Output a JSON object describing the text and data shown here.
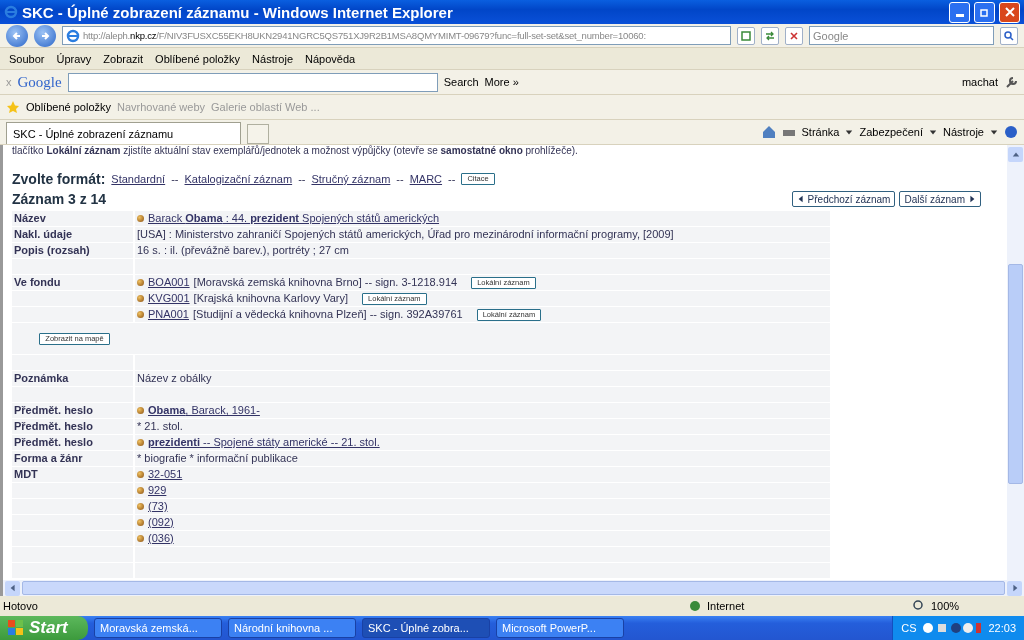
{
  "window": {
    "title": "SKC - Úplné zobrazení záznamu - Windows Internet Explorer"
  },
  "address": {
    "url_prefix": "http://aleph.",
    "url_host": "nkp.cz",
    "url_rest": "/F/NIV3FUSXC55EKH8UKN2941NGRC5QS751XJ9R2B1MSA8QMYMIMT-09679?func=full-set-set&set_number=10060:",
    "search_placeholder": "Google"
  },
  "menu": [
    "Soubor",
    "Úpravy",
    "Zobrazit",
    "Oblíbené položky",
    "Nástroje",
    "Nápověda"
  ],
  "google_bar": {
    "close": "x",
    "logo": "Google",
    "search": "Search",
    "more": "More »",
    "user": "machat"
  },
  "favorites_bar": {
    "favorites": "Oblíbené položky",
    "items": [
      "Navrhované weby",
      "Galerie oblastí Web ..."
    ]
  },
  "tabs": [
    {
      "label": "SKC - Úplné zobrazení záznamu",
      "selected": true
    }
  ],
  "command_bar": [
    "Stránka",
    "Zabezpečení",
    "Nástroje"
  ],
  "page": {
    "intro": "tlačítko **Lokální záznam** zjistíte aktuální stav exemplářů/jednotek a možnost výpůjčky (otevře se **samostatné okno** prohlížeče).",
    "format_label": "Zvolte formát:",
    "formats": [
      {
        "kind": "link",
        "label": "Standardní"
      },
      {
        "kind": "sep",
        "label": "--"
      },
      {
        "kind": "link",
        "label": "Katalogizační záznam"
      },
      {
        "kind": "sep",
        "label": "--"
      },
      {
        "kind": "link",
        "label": "Stručný záznam"
      },
      {
        "kind": "sep",
        "label": "--"
      },
      {
        "kind": "link",
        "label": "MARC"
      },
      {
        "kind": "sep",
        "label": "--"
      },
      {
        "kind": "button",
        "label": "Citace"
      }
    ],
    "record_title": "Záznam 3 z 14",
    "prev": "Předchozí záznam",
    "next": "Další záznam",
    "rows": [
      {
        "label": "Název",
        "kind": "link",
        "value": "Barack **Obama** : 44. **prezident** Spojených států amerických"
      },
      {
        "label": "Nakl. údaje",
        "kind": "text",
        "value": "[USA] : Ministerstvo zahraničí Spojených států amerických, Úřad pro mezinárodní informační programy, [2009]"
      },
      {
        "label": "Popis (rozsah)",
        "kind": "text",
        "value": "16 s. : il. (převážně barev.), portréty ; 27 cm"
      },
      {
        "kind": "empty"
      },
      {
        "label": "Ve fondu",
        "kind": "holding",
        "code": "BOA001",
        "value": "[Moravská zemská knihovna Brno] -- sign. 3-1218.914",
        "button": "Lokální záznam"
      },
      {
        "kind": "holding",
        "code": "KVG001",
        "value": "[Krajská knihovna Karlovy Vary]",
        "button": "Lokální záznam"
      },
      {
        "kind": "holding",
        "code": "PNA001",
        "value": "[Studijní a vědecká knihovna Plzeň] -- sign. 392A39761",
        "button": "Lokální záznam"
      },
      {
        "kind": "map",
        "button": "Zobrazit na mapě"
      },
      {
        "kind": "empty"
      },
      {
        "label": "Poznámka",
        "kind": "text",
        "value": "Název z obálky"
      },
      {
        "kind": "empty"
      },
      {
        "label": "Předmět. heslo",
        "kind": "link",
        "value": "**Obama**, Barack, 1961-"
      },
      {
        "label": "Předmět. heslo",
        "kind": "text",
        "value": "* 21. stol."
      },
      {
        "label": "Předmět. heslo",
        "kind": "link",
        "value": "**prezidenti** -- Spojené státy americké -- 21. stol."
      },
      {
        "label": "Forma a žánr",
        "kind": "text",
        "value": "* biografie * informační publikace"
      },
      {
        "label": "MDT",
        "kind": "link",
        "value": "32-051"
      },
      {
        "kind": "link",
        "value": "929"
      },
      {
        "kind": "link",
        "value": "(73)"
      },
      {
        "kind": "link",
        "value": "(092)"
      },
      {
        "kind": "link",
        "value": "(036)"
      },
      {
        "kind": "empty"
      },
      {
        "kind": "empty"
      }
    ]
  },
  "status_bar": {
    "text": "Hotovo",
    "zone": "Internet",
    "zoom": "100%"
  },
  "taskbar": {
    "start": "Start",
    "tasks": [
      {
        "label": "Moravská zemská...",
        "selected": false
      },
      {
        "label": "Národní knihovna ...",
        "selected": false
      },
      {
        "label": "SKC - Úplné zobra...",
        "selected": true
      },
      {
        "label": "Microsoft PowerP...",
        "selected": false
      }
    ],
    "lang": "CS",
    "clock": "22:03"
  }
}
